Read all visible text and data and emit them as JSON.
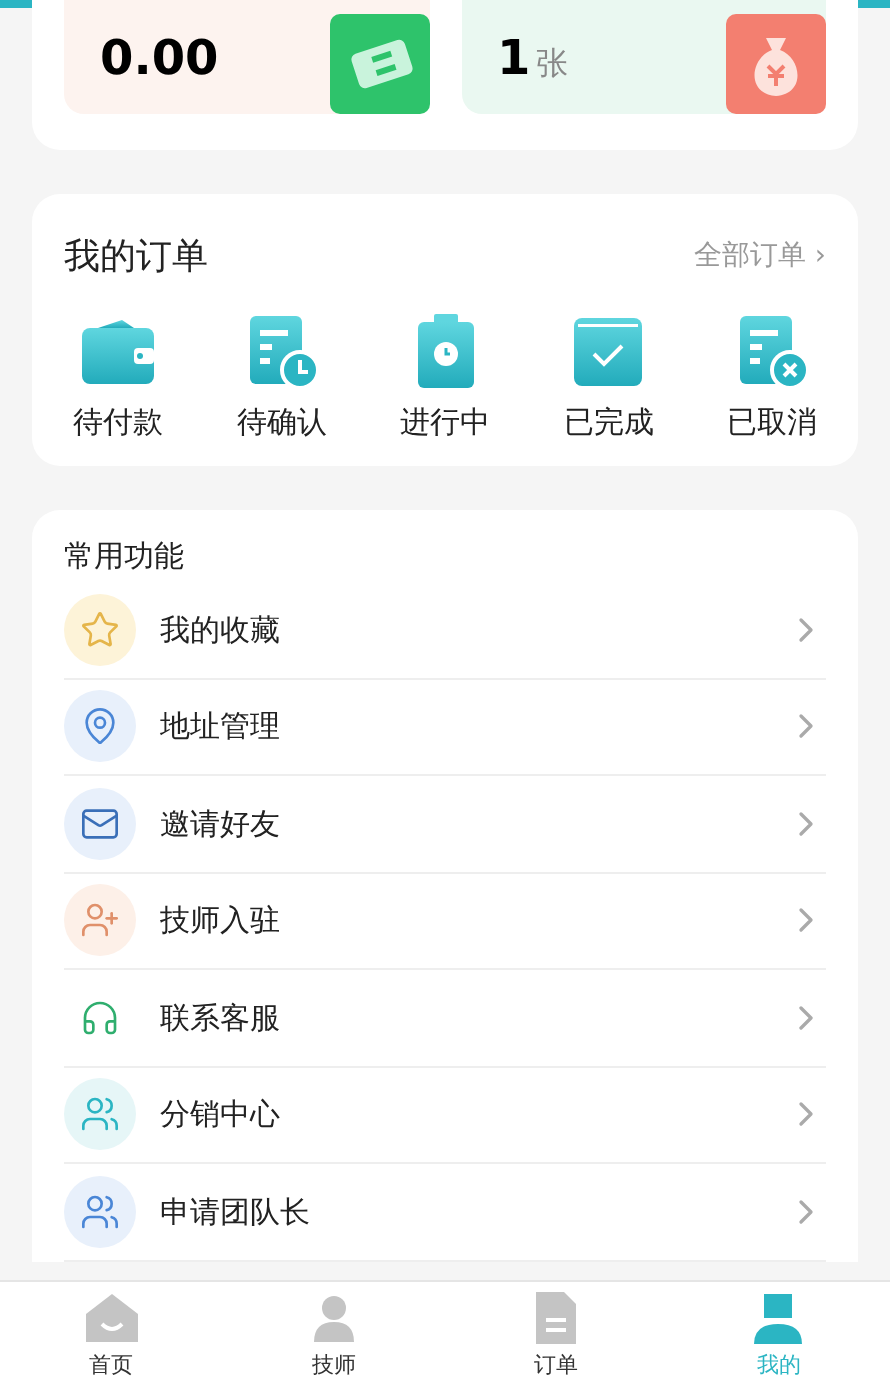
{
  "stats": [
    {
      "kind": "ticket",
      "value": "0.00"
    },
    {
      "kind": "money-bag",
      "value": "1",
      "unit": "张"
    }
  ],
  "orders": {
    "title": "我的订单",
    "link": "全部订单 ›",
    "items": [
      {
        "kind": "wallet",
        "label": "待付款"
      },
      {
        "kind": "doc-clock",
        "label": "待确认"
      },
      {
        "kind": "clipboard",
        "label": "进行中"
      },
      {
        "kind": "check",
        "label": "已完成"
      },
      {
        "kind": "doc-x",
        "label": "已取消"
      }
    ]
  },
  "functions": {
    "title": "常用功能",
    "items": [
      {
        "kind": "star",
        "label": "我的收藏",
        "color": "#fdf3d8"
      },
      {
        "kind": "pin",
        "label": "地址管理",
        "color": "#e8f0fb"
      },
      {
        "kind": "mail",
        "label": "邀请好友",
        "color": "#e8f0fb"
      },
      {
        "kind": "user-plus",
        "label": "技师入驻",
        "color": "#fdf0e8"
      },
      {
        "kind": "headset",
        "label": "联系客服",
        "color": "#ffffff"
      },
      {
        "kind": "users",
        "label": "分销中心",
        "color": "#e6f6f7"
      },
      {
        "kind": "team",
        "label": "申请团队长",
        "color": "#e8f0fb"
      }
    ]
  },
  "tabs": [
    {
      "kind": "home",
      "label": "首页",
      "selected": false
    },
    {
      "kind": "tech",
      "label": "技师",
      "selected": false
    },
    {
      "kind": "order",
      "label": "订单",
      "selected": false
    },
    {
      "kind": "me",
      "label": "我的",
      "selected": true
    }
  ]
}
